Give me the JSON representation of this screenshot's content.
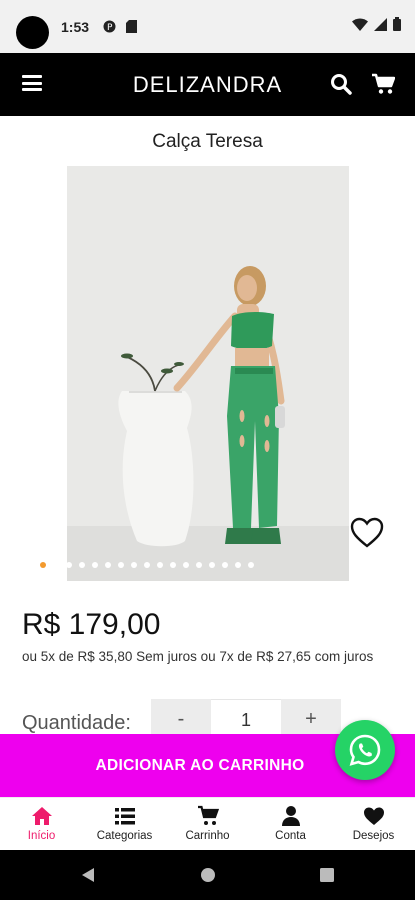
{
  "status_bar": {
    "time": "1:53",
    "icons": [
      "camera-cutout",
      "app-notification-icon",
      "sd-card-icon",
      "wifi-icon",
      "signal-icon",
      "battery-icon"
    ]
  },
  "header": {
    "brand": "DELIZANDRA",
    "icons": [
      "menu-icon",
      "search-icon",
      "cart-icon"
    ]
  },
  "product": {
    "title": "Calça Teresa",
    "price": "R$ 179,00",
    "installments": "ou 5x de R$ 35,80 Sem juros ou 7x de R$ 27,65 com juros",
    "image_count": 17,
    "active_image_index": 0
  },
  "quantity": {
    "label": "Quantidade:",
    "minus": "-",
    "value": "1",
    "plus": "+"
  },
  "actions": {
    "add_to_cart": "ADICIONAR AO CARRINHO"
  },
  "bottom_nav": {
    "items": [
      {
        "label": "Início",
        "icon": "home-icon",
        "active": true
      },
      {
        "label": "Categorias",
        "icon": "list-icon",
        "active": false
      },
      {
        "label": "Carrinho",
        "icon": "cart-icon",
        "active": false
      },
      {
        "label": "Conta",
        "icon": "user-icon",
        "active": false
      },
      {
        "label": "Desejos",
        "icon": "heart-icon",
        "active": false
      }
    ]
  },
  "colors": {
    "header_bg": "#000000",
    "add_to_cart_bg": "#ee00ee",
    "active_nav": "#ee1b6b",
    "whatsapp": "#25d366",
    "active_dot": "#f39a2e"
  }
}
